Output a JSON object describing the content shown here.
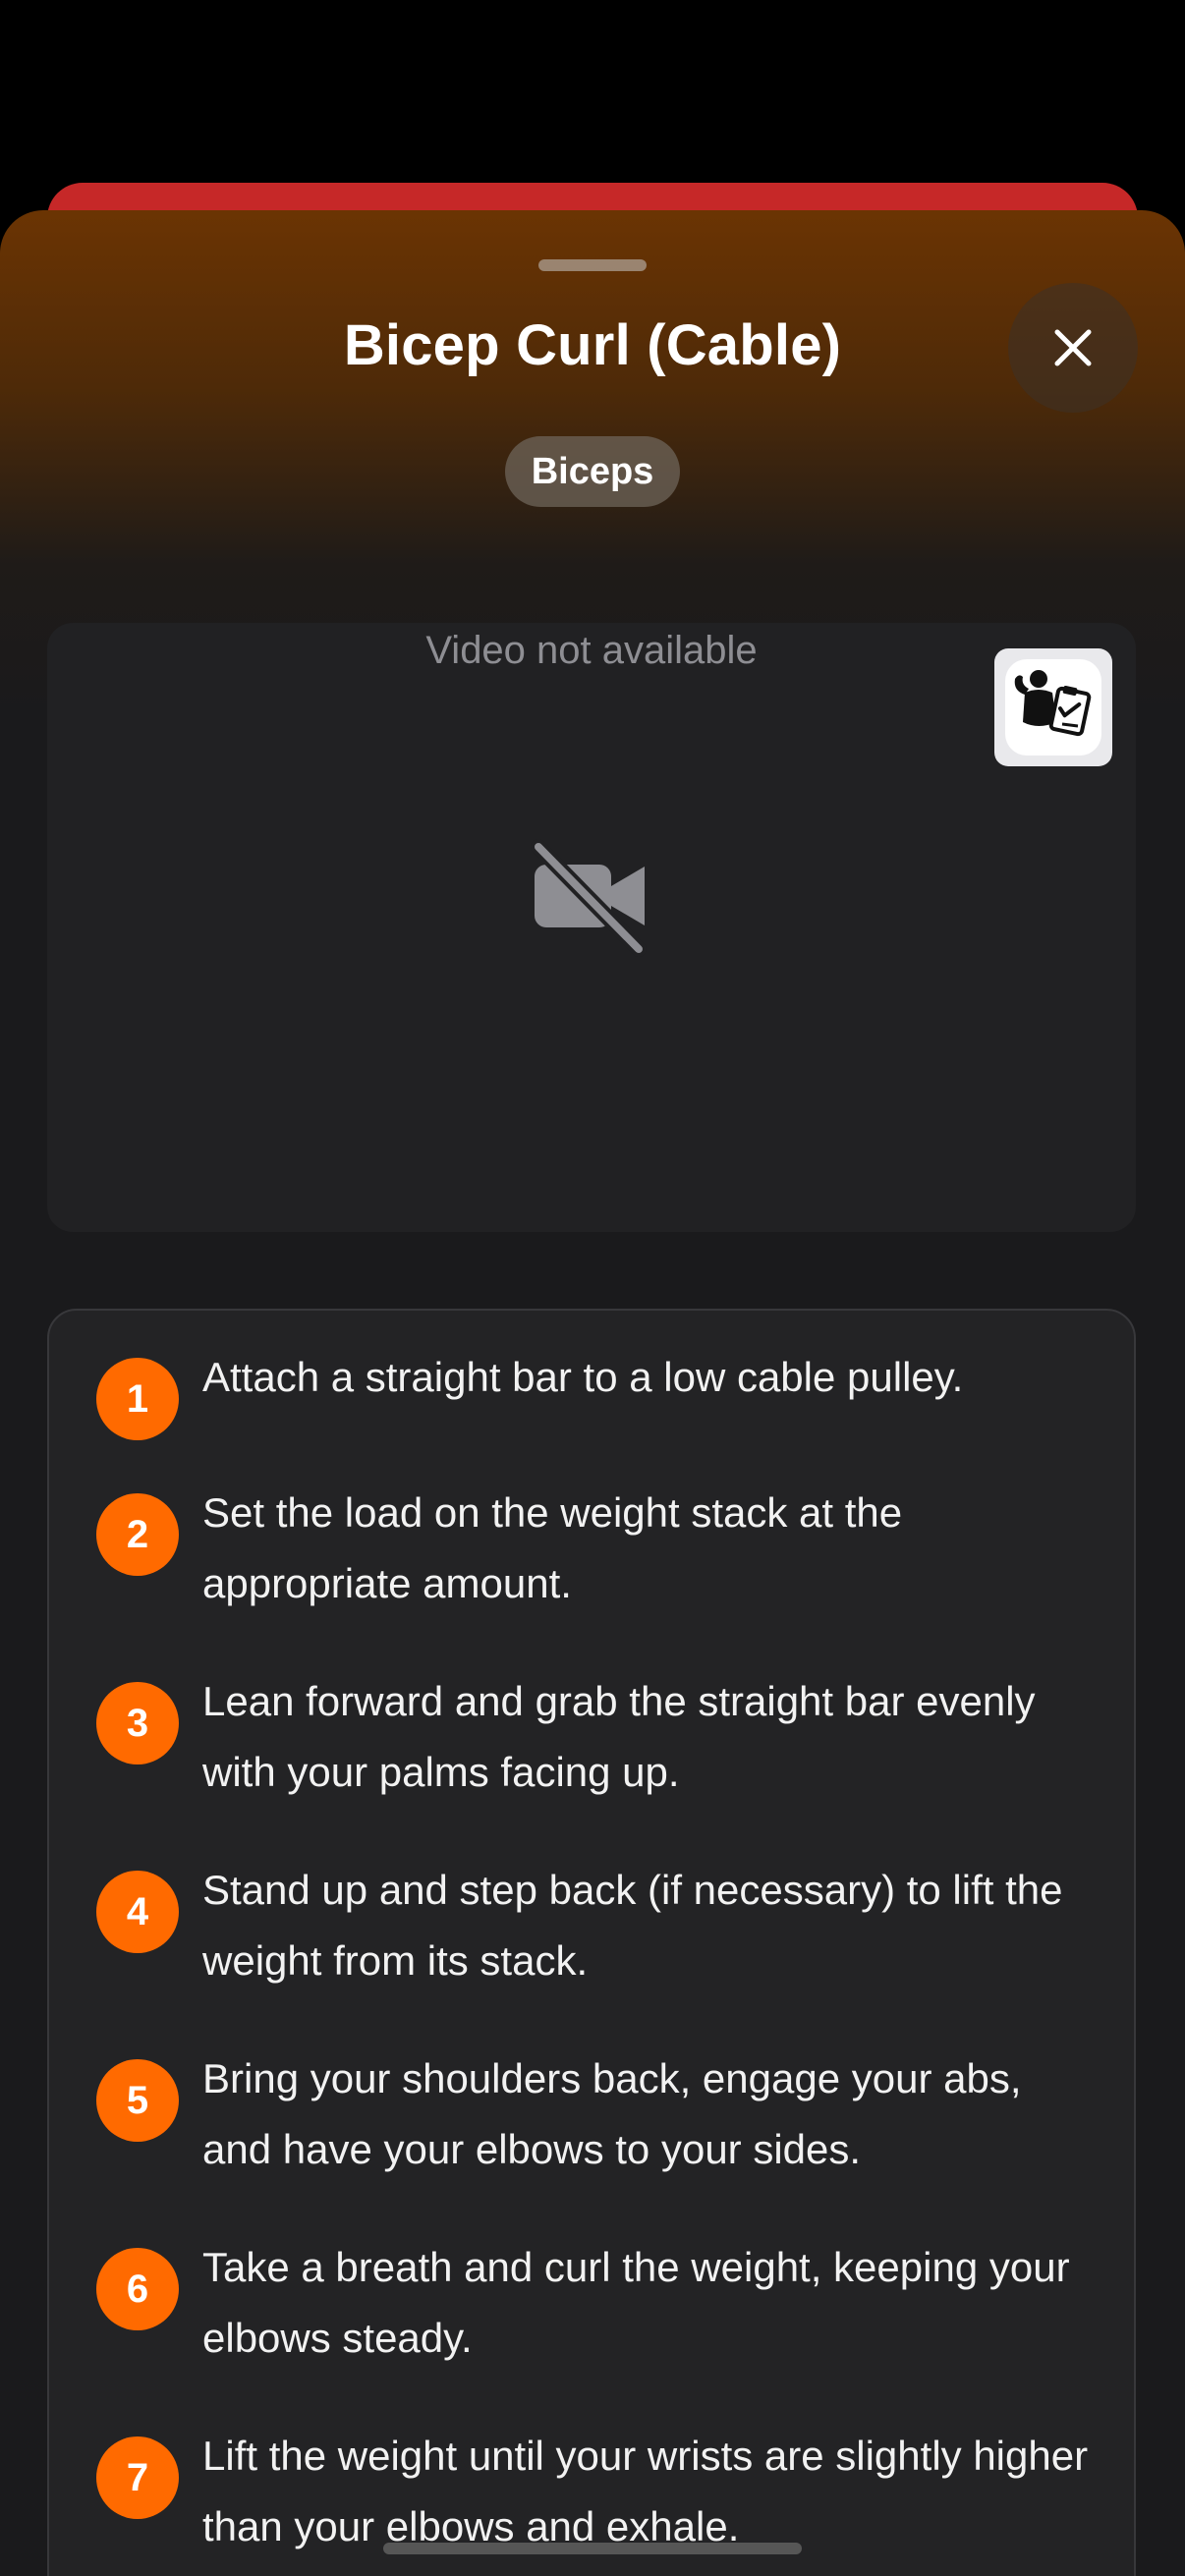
{
  "sheet": {
    "title": "Bicep Curl (Cable)",
    "muscle_chip": "Biceps",
    "close_icon": "close-icon"
  },
  "video": {
    "status_text": "Video not available",
    "status_icon": "video-off-icon",
    "app_badge_icon": "muscle-man-clipboard-icon"
  },
  "instructions": [
    {
      "number": "1",
      "text": "Attach a straight bar to a low cable pulley."
    },
    {
      "number": "2",
      "text": "Set the load on the weight stack at the appropriate amount."
    },
    {
      "number": "3",
      "text": "Lean forward and grab the straight bar evenly with your palms facing up."
    },
    {
      "number": "4",
      "text": "Stand up and step back (if necessary) to lift the weight from its stack."
    },
    {
      "number": "5",
      "text": "Bring your shoulders back, engage your abs, and have your elbows to your sides."
    },
    {
      "number": "6",
      "text": "Take a breath and curl the weight, keeping your elbows steady."
    },
    {
      "number": "7",
      "text": "Lift the weight until your wrists are slightly higher than your elbows and exhale."
    }
  ],
  "colors": {
    "step_badge": "#ff6a00",
    "behind_card": "#c62828",
    "header_gradient_top": "#6b3403"
  }
}
